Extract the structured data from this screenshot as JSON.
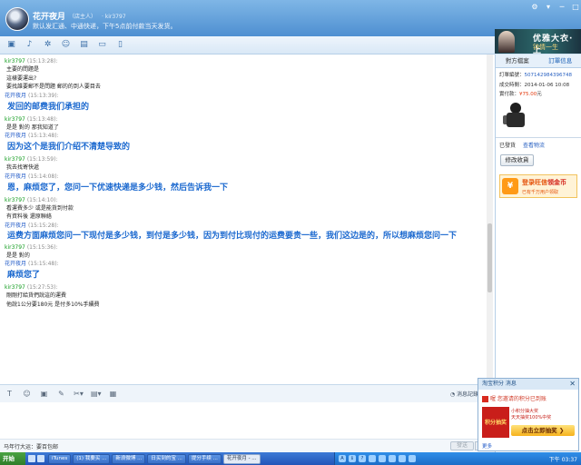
{
  "window": {
    "name": "花开夜月",
    "tag": "（店主人）",
    "id": "· kir3797",
    "status": "默认发汇通、中通快递，下午5点前付款当天发货。",
    "controls": [
      "⚙",
      "▾",
      "─",
      "□",
      "✕"
    ]
  },
  "toolbar": {
    "icons": [
      {
        "name": "folder-icon",
        "glyph": "▣"
      },
      {
        "name": "microphone-icon",
        "glyph": "♪"
      },
      {
        "name": "settings-icon",
        "glyph": "✲"
      },
      {
        "name": "contacts-icon",
        "glyph": "☺"
      },
      {
        "name": "screen-icon",
        "glyph": "▤"
      },
      {
        "name": "computer-icon",
        "glyph": "▭"
      },
      {
        "name": "phone-icon",
        "glyph": "▯"
      }
    ]
  },
  "banner": {
    "line1": "优雅大衣·上",
    "line2": "钟情一生"
  },
  "chat": {
    "messages": [
      {
        "role": "buyer",
        "name": "kir3797",
        "time": "(15:13:28):",
        "lines": [
          "主要的問題是",
          "這樣要運出?",
          "要找誰要郵不是問題 郵的的到人要目去"
        ]
      },
      {
        "role": "seller",
        "name": "花开夜月",
        "time": "(15:13:39):",
        "lines": [
          "发回的邮费我们承担的"
        ]
      },
      {
        "role": "buyer",
        "name": "kir3797",
        "time": "(15:13:48):",
        "lines": [
          "是是 對的 那我知道了"
        ]
      },
      {
        "role": "seller",
        "name": "花开夜月",
        "time": "(15:13:48):",
        "lines": [
          "因为这个是我们介绍不清楚导致的"
        ]
      },
      {
        "role": "buyer",
        "name": "kir3797",
        "time": "(15:13:59):",
        "lines": [
          "我去找寄快遞"
        ]
      },
      {
        "role": "seller",
        "name": "花开夜月",
        "time": "(15:14:08):",
        "lines": [
          "恩，麻烦您了，您问一下优速快递是多少钱，然后告诉我一下"
        ]
      },
      {
        "role": "buyer",
        "name": "kir3797",
        "time": "(15:14:10):",
        "lines": [
          "看運費多少 或是能貨到付款",
          "有資料後 還原聯絡"
        ]
      },
      {
        "role": "seller",
        "name": "花开夜月",
        "time": "(15:15:28):",
        "lines": [
          "运费方面麻烦您问一下现付是多少钱，到付是多少钱，因为到付比现付的运费要贵一些，我们这边是的，所以想麻烦您问一下"
        ],
        "wrap": true
      },
      {
        "role": "buyer",
        "name": "kir3797",
        "time": "(15:15:36):",
        "lines": [
          "是是 對的"
        ]
      },
      {
        "role": "seller",
        "name": "花开夜月",
        "time": "(15:15:48):",
        "lines": [
          "麻烦您了"
        ]
      },
      {
        "role": "buyer",
        "name": "kir3797",
        "time": "(15:27:53):",
        "lines": [
          "剛剛打給貨們說這的運費",
          "他說1公分要180元  是付多10%手續費"
        ]
      }
    ]
  },
  "inputbar": {
    "icons": [
      {
        "name": "font-icon",
        "glyph": "T"
      },
      {
        "name": "emoji-icon",
        "glyph": "☺"
      },
      {
        "name": "image-icon",
        "glyph": "▣"
      },
      {
        "name": "edit-icon",
        "glyph": "✎"
      },
      {
        "name": "scissors-icon",
        "glyph": "✂▾"
      },
      {
        "name": "window-icon",
        "glyph": "▤▾"
      },
      {
        "name": "box-icon",
        "glyph": "▦"
      }
    ],
    "history_label": "◔ 消息記錄",
    "footnote": "马年行大运：要百包邮",
    "send_label": "發送",
    "send_more": "▾"
  },
  "rpanel": {
    "tab1": "對方檔案",
    "tab2": "訂單信息",
    "order_no_label": "訂單編號：",
    "order_no": "507142984396748",
    "time_label": "成交時間：",
    "time": "2014-01-06 10:08",
    "paid_label": "實付款：",
    "paid": "¥75.00",
    "paid_unit": "元",
    "status_label": "已發貨",
    "logistics_label": "查看物流",
    "modify_button": "修改收貨",
    "ad_title": "登录旺信",
    "ad_title_highlight": "领金币",
    "ad_sub": "已有千万用户领取"
  },
  "popup": {
    "title": "淘宝积分 消息",
    "close": "✕",
    "line1": "喔 您邀请的积分已到账",
    "box_text": "积分抽奖",
    "line2a": "小积分抽大奖",
    "line2b": "天天抽奖100%中奖",
    "button": "点击立即抽奖 ❯",
    "more": "更多"
  },
  "taskbar": {
    "start": "开始",
    "tasks": [
      {
        "label": "iTunes",
        "on": false
      },
      {
        "label": "(1) 我要买 ...",
        "on": false
      },
      {
        "label": "新浪微博 ...",
        "on": false
      },
      {
        "label": "日买到的宝 ...",
        "on": false
      },
      {
        "label": "提分手续 ...",
        "on": false
      },
      {
        "label": "花开夜月 - ...",
        "on": true
      }
    ],
    "clock": "下午 03:37"
  },
  "colors": {
    "accent": "#1a68cf",
    "buyer": "#0f9b1c",
    "seller": "#1f59c7",
    "titlebar": "#4e8fd1"
  }
}
